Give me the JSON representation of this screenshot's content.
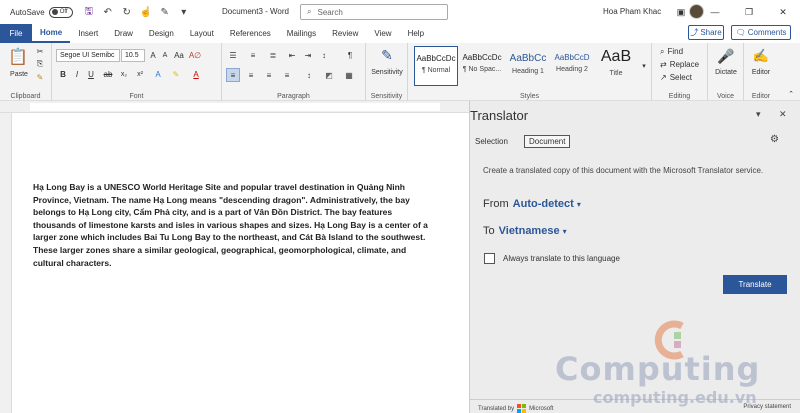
{
  "titlebar": {
    "autosave_label": "AutoSave",
    "autosave_state": "Off",
    "doc_title": "Document3 - Word",
    "search_placeholder": "Search",
    "user_name": "Hoa Pham Khac"
  },
  "tabs": [
    "File",
    "Home",
    "Insert",
    "Draw",
    "Design",
    "Layout",
    "References",
    "Mailings",
    "Review",
    "View",
    "Help"
  ],
  "share_label": "Share",
  "comments_label": "Comments",
  "ribbon": {
    "clipboard": {
      "paste": "Paste",
      "label": "Clipboard"
    },
    "font": {
      "name": "Segoe UI Semibc",
      "size": "10.5",
      "label": "Font"
    },
    "paragraph": {
      "label": "Paragraph"
    },
    "sensitivity": {
      "button": "Sensitivity",
      "label": "Sensitivity"
    },
    "styles": {
      "label": "Styles",
      "items": [
        {
          "sample": "AaBbCcDc",
          "name": "¶ Normal"
        },
        {
          "sample": "AaBbCcDc",
          "name": "¶ No Spac..."
        },
        {
          "sample": "AaBbCc",
          "name": "Heading 1"
        },
        {
          "sample": "AaBbCcD",
          "name": "Heading 2"
        },
        {
          "sample": "AaB",
          "name": "Title"
        }
      ]
    },
    "editing": {
      "find": "Find",
      "replace": "Replace",
      "select": "Select",
      "label": "Editing"
    },
    "voice": {
      "dictate": "Dictate",
      "label": "Voice"
    },
    "editor": {
      "button": "Editor",
      "label": "Editor"
    }
  },
  "document": {
    "body": "Hạ Long Bay is a UNESCO World Heritage Site and popular travel destination in Quảng Ninh Province, Vietnam. The name Hạ Long means \"descending dragon\". Administratively, the bay belongs to Hạ Long city, Cẩm Phả city, and is a part of Vân Đồn District. The bay features thousands of limestone karsts and isles in various shapes and sizes. Hạ Long Bay is a center of a larger zone which includes Bai Tu Long Bay to the northeast, and Cát Bà Island to the southwest. These larger zones share a similar geological, geographical, geomorphological, climate, and cultural characters."
  },
  "translator": {
    "title": "Translator",
    "tab_selection": "Selection",
    "tab_document": "Document",
    "description": "Create a translated copy of this document with the Microsoft Translator service.",
    "from_label": "From",
    "from_value": "Auto-detect",
    "to_label": "To",
    "to_value": "Vietnamese",
    "checkbox_label": "Always translate to this language",
    "translate_button": "Translate",
    "footer_left": "Translated by",
    "footer_brand": "Microsoft",
    "footer_right": "Privacy statement"
  },
  "watermark": {
    "brand": "Computing",
    "url": "computing.edu.vn"
  },
  "colors": {
    "accent": "#2b579a",
    "save_icon": "#7b3fa0"
  }
}
